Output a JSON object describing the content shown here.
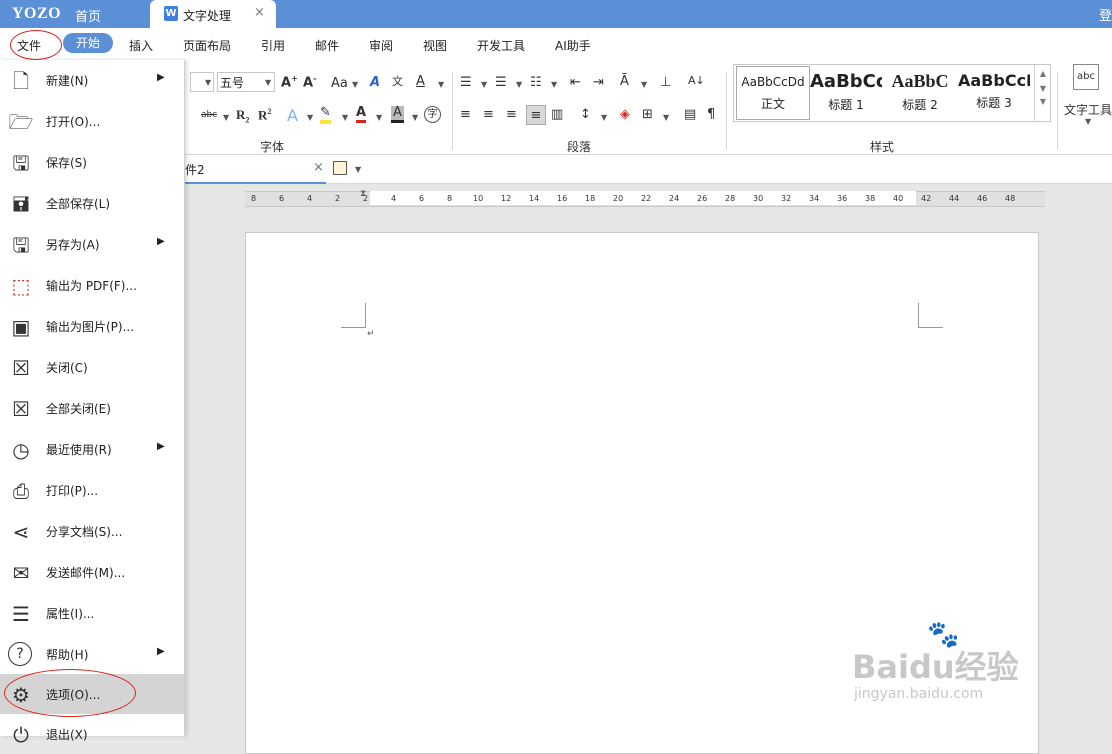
{
  "titlebar": {
    "logo": "YOZO",
    "home": "首页",
    "tab_icon": "W",
    "tab_label": "文字处理",
    "tab_close": "×",
    "login": "登"
  },
  "menubar": {
    "file": "文件",
    "start": "开始",
    "insert": "插入",
    "layout": "页面布局",
    "reference": "引用",
    "mail": "邮件",
    "review": "审阅",
    "view": "视图",
    "developer": "开发工具",
    "ai": "AI助手"
  },
  "ribbon": {
    "font_size": "五号",
    "group_font": "字体",
    "group_paragraph": "段落",
    "group_styles": "样式",
    "text_tool": "文字工具",
    "styles": [
      {
        "preview": "AaBbCcDd",
        "name": "正文"
      },
      {
        "preview": "AaBbCc",
        "name": "标题 1"
      },
      {
        "preview": "AaBbC",
        "name": "标题 2"
      },
      {
        "preview": "AaBbCcD",
        "name": "标题 3"
      }
    ]
  },
  "doc_tab": {
    "label": "件2",
    "close": "×"
  },
  "ruler": {
    "ticks": [
      "8",
      "6",
      "4",
      "2",
      "2",
      "4",
      "6",
      "8",
      "10",
      "12",
      "14",
      "16",
      "18",
      "20",
      "22",
      "24",
      "26",
      "28",
      "30",
      "32",
      "34",
      "36",
      "38",
      "40",
      "42",
      "44",
      "46",
      "48"
    ]
  },
  "file_menu": {
    "items": [
      {
        "label": "新建(N)",
        "icon": "new-doc-icon",
        "submenu": true
      },
      {
        "label": "打开(O)...",
        "icon": "folder-open-icon",
        "submenu": false
      },
      {
        "label": "保存(S)",
        "icon": "save-icon",
        "submenu": false
      },
      {
        "label": "全部保存(L)",
        "icon": "save-all-icon",
        "submenu": false
      },
      {
        "label": "另存为(A)",
        "icon": "save-as-icon",
        "submenu": true
      },
      {
        "label": "输出为 PDF(F)...",
        "icon": "pdf-icon",
        "submenu": false
      },
      {
        "label": "输出为图片(P)...",
        "icon": "image-export-icon",
        "submenu": false
      },
      {
        "label": "关闭(C)",
        "icon": "close-doc-icon",
        "submenu": false
      },
      {
        "label": "全部关闭(E)",
        "icon": "close-all-icon",
        "submenu": false
      },
      {
        "label": "最近使用(R)",
        "icon": "recent-clock-icon",
        "submenu": true
      },
      {
        "label": "打印(P)...",
        "icon": "printer-icon",
        "submenu": false
      },
      {
        "label": "分享文档(S)...",
        "icon": "share-icon",
        "submenu": false
      },
      {
        "label": "发送邮件(M)...",
        "icon": "mail-icon",
        "submenu": false
      },
      {
        "label": "属性(I)...",
        "icon": "properties-list-icon",
        "submenu": false
      },
      {
        "label": "帮助(H)",
        "icon": "help-icon",
        "submenu": true
      },
      {
        "label": "选项(O)...",
        "icon": "gear-icon",
        "submenu": false,
        "selected": true
      },
      {
        "label": "退出(X)",
        "icon": "exit-icon",
        "submenu": false
      }
    ]
  },
  "watermark": {
    "brand": "Baidu经验",
    "url": "jingyan.baidu.com"
  },
  "colors": {
    "accent": "#5b8fd6",
    "annotation": "#d9261c"
  }
}
